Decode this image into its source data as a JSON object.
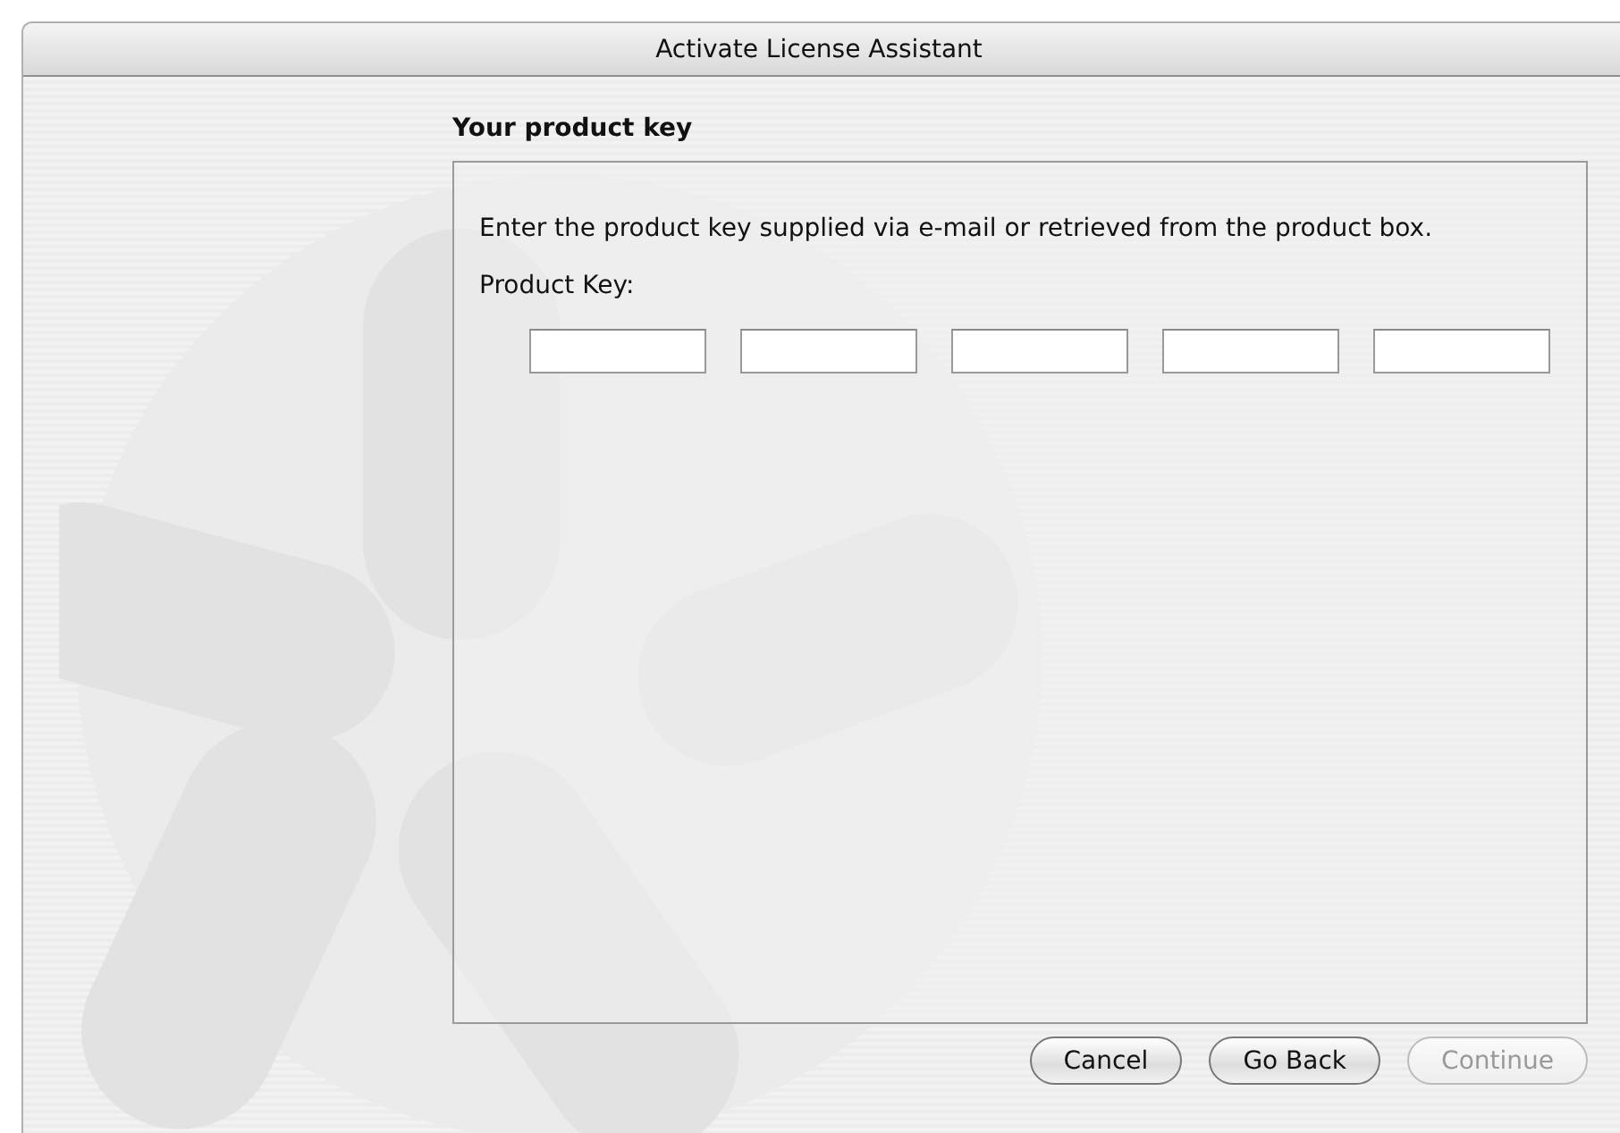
{
  "window": {
    "title": "Activate License Assistant"
  },
  "heading": "Your product key",
  "panel": {
    "instructions": "Enter the product key supplied via e-mail or retrieved from the product box.",
    "field_label": "Product Key:",
    "key_fields": [
      {
        "disabled": false
      },
      {
        "disabled": false
      },
      {
        "disabled": false
      },
      {
        "disabled": false
      },
      {
        "disabled": false
      }
    ]
  },
  "buttons": [
    {
      "label": "Cancel",
      "disabled": false
    },
    {
      "label": "Go Back",
      "disabled": false
    },
    {
      "label": "Continue",
      "disabled": true
    }
  ]
}
